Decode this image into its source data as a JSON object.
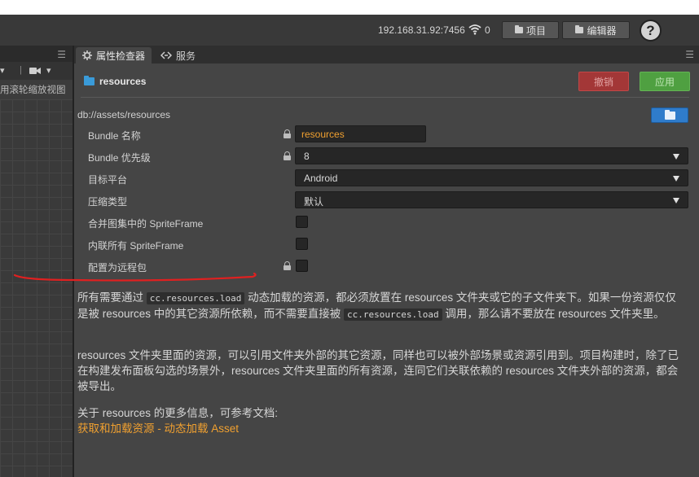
{
  "topbar": {
    "ip": "192.168.31.92:7456",
    "connection_count": "0",
    "project_button": "项目",
    "editor_button": "编辑器",
    "help_label": "?"
  },
  "scene_panel": {
    "toolbar_separator": "|",
    "label": "用滚轮缩放视图"
  },
  "inspector": {
    "tabs": [
      {
        "label": "属性检查器"
      },
      {
        "label": "服务"
      }
    ],
    "asset_name": "resources",
    "revert_button": "撤销",
    "apply_button": "应用",
    "path": "db://assets/resources",
    "properties": {
      "bundle_name": {
        "label": "Bundle 名称",
        "value": "resources"
      },
      "bundle_priority": {
        "label": "Bundle 优先级",
        "value": "8"
      },
      "target_platform": {
        "label": "目标平台",
        "value": "Android"
      },
      "compression_type": {
        "label": "压缩类型",
        "value": "默认"
      },
      "merge_sprite_frames": {
        "label": "合并图集中的 SpriteFrame",
        "checked": false
      },
      "inline_sprite_frames": {
        "label": "内联所有 SpriteFrame",
        "checked": false
      },
      "remote_bundle": {
        "label": "配置为远程包",
        "checked": false
      }
    },
    "description": {
      "p1_a": "所有需要通过 ",
      "p1_code1": "cc.resources.load",
      "p1_b": " 动态加载的资源，都必须放置在 resources 文件夹或它的子文件夹下。如果一份资源仅仅是被 resources 中的其它资源所依赖，而不需要直接被 ",
      "p1_code2": "cc.resources.load",
      "p1_c": " 调用，那么请不要放在 resources 文件夹里。",
      "p2": "resources 文件夹里面的资源，可以引用文件夹外部的其它资源，同样也可以被外部场景或资源引用到。项目构建时，除了已在构建发布面板勾选的场景外，resources 文件夹里面的所有资源，连同它们关联依赖的 resources 文件夹外部的资源，都会被导出。",
      "p3": "关于 resources 的更多信息，可参考文档:",
      "link": "获取和加载资源 - 动态加载 Asset"
    }
  },
  "colors": {
    "revert": "#a33737",
    "apply": "#4fa041",
    "accent_blue": "#2f7ccb",
    "link_orange": "#f0a030",
    "annotation_red": "#e02020"
  }
}
